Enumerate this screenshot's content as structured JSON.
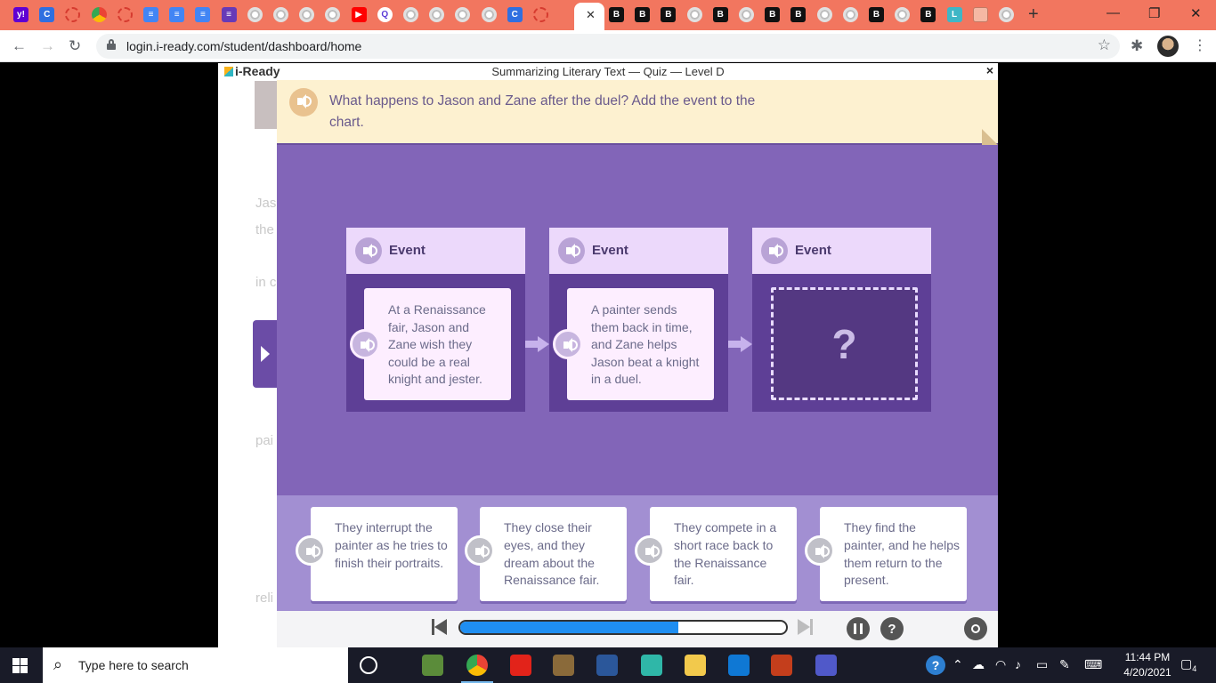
{
  "browser": {
    "tabs": [
      {
        "icon": "yahoo-icon",
        "glyph": "y!",
        "cls": "y"
      },
      {
        "icon": "c-app-icon",
        "glyph": "C",
        "cls": "c"
      },
      {
        "icon": "loading-icon",
        "glyph": "",
        "cls": "dots"
      },
      {
        "icon": "chrome-icon",
        "glyph": "",
        "cls": "ch"
      },
      {
        "icon": "loading-icon",
        "glyph": "",
        "cls": "dots"
      },
      {
        "icon": "google-docs-icon",
        "glyph": "≡",
        "cls": "docs"
      },
      {
        "icon": "google-docs-icon",
        "glyph": "≡",
        "cls": "docs"
      },
      {
        "icon": "google-docs-icon",
        "glyph": "≡",
        "cls": "docs"
      },
      {
        "icon": "google-forms-icon",
        "glyph": "≡",
        "cls": "form"
      },
      {
        "icon": "google-icon",
        "glyph": "",
        "cls": "g"
      },
      {
        "icon": "google-icon",
        "glyph": "",
        "cls": "g"
      },
      {
        "icon": "google-icon",
        "glyph": "",
        "cls": "g"
      },
      {
        "icon": "google-icon",
        "glyph": "",
        "cls": "g"
      },
      {
        "icon": "youtube-icon",
        "glyph": "▶",
        "cls": "yt"
      },
      {
        "icon": "quizlet-icon",
        "glyph": "Q",
        "cls": "q"
      },
      {
        "icon": "google-icon",
        "glyph": "",
        "cls": "g"
      },
      {
        "icon": "google-icon",
        "glyph": "",
        "cls": "g"
      },
      {
        "icon": "google-icon",
        "glyph": "",
        "cls": "g"
      },
      {
        "icon": "google-icon",
        "glyph": "",
        "cls": "g"
      },
      {
        "icon": "c-app-icon",
        "glyph": "C",
        "cls": "c"
      },
      {
        "icon": "loading-icon",
        "glyph": "",
        "cls": "dots"
      }
    ],
    "tabs_right": [
      {
        "icon": "b-app-icon",
        "glyph": "B",
        "cls": "b"
      },
      {
        "icon": "b-app-icon",
        "glyph": "B",
        "cls": "b"
      },
      {
        "icon": "b-app-icon",
        "glyph": "B",
        "cls": "b"
      },
      {
        "icon": "google-icon",
        "glyph": "",
        "cls": "g"
      },
      {
        "icon": "b-app-icon",
        "glyph": "B",
        "cls": "b"
      },
      {
        "icon": "google-icon",
        "glyph": "",
        "cls": "g"
      },
      {
        "icon": "b-app-icon",
        "glyph": "B",
        "cls": "b"
      },
      {
        "icon": "b-app-icon",
        "glyph": "B",
        "cls": "b"
      },
      {
        "icon": "google-icon",
        "glyph": "",
        "cls": "g"
      },
      {
        "icon": "google-icon",
        "glyph": "",
        "cls": "g"
      },
      {
        "icon": "b-app-icon",
        "glyph": "B",
        "cls": "b"
      },
      {
        "icon": "google-icon",
        "glyph": "",
        "cls": "g"
      },
      {
        "icon": "b-app-icon",
        "glyph": "B",
        "cls": "b"
      },
      {
        "icon": "l-app-icon",
        "glyph": "L",
        "cls": "lt"
      },
      {
        "icon": "calendar-icon",
        "glyph": "",
        "cls": "cal"
      },
      {
        "icon": "google-icon",
        "glyph": "",
        "cls": "g"
      }
    ],
    "url": "login.i-ready.com/student/dashboard/home"
  },
  "app": {
    "brand": "i-Ready",
    "title": "Summarizing Literary Text — Quiz — Level D",
    "close": "×"
  },
  "background_doc": {
    "fragments": [
      "Jas",
      "the",
      "in c",
      "pai",
      "reli"
    ]
  },
  "prompt": {
    "text": "What happens to Jason and Zane after the duel? Add the event to the chart."
  },
  "events": [
    {
      "label": "Event",
      "text": "At a Renaissance fair, Jason and Zane wish they could be a real knight and jester."
    },
    {
      "label": "Event",
      "text": "A painter sends them back in time, and Zane helps Jason beat a knight in a duel."
    },
    {
      "label": "Event",
      "text": "",
      "placeholder": "?"
    }
  ],
  "answers": [
    {
      "text": "They interrupt the painter as he tries to finish their portraits."
    },
    {
      "text": "They close their eyes, and they dream about the Renaissance fair."
    },
    {
      "text": "They compete in a short race back to the Renaissance fair."
    },
    {
      "text": "They find the painter, and he helps them return to the present."
    }
  ],
  "controls": {
    "progress_fraction": 0.67,
    "help": "?"
  },
  "taskbar": {
    "search_placeholder": "Type here to search",
    "time": "11:44 PM",
    "date": "4/20/2021",
    "notifications": "4",
    "apps": [
      {
        "name": "cortana-icon",
        "color": "transparent"
      },
      {
        "name": "minecraft-icon",
        "color": "#5b8c3a"
      },
      {
        "name": "chrome-icon",
        "color": "conic"
      },
      {
        "name": "roblox-icon",
        "color": "#e2231a"
      },
      {
        "name": "minecraft-dungeons-icon",
        "color": "#8a6a3a"
      },
      {
        "name": "word-icon",
        "color": "#2b579a"
      },
      {
        "name": "edge-icon",
        "color": "#2fb7a8"
      },
      {
        "name": "file-explorer-icon",
        "color": "#f2c94c"
      },
      {
        "name": "edge-browser-icon",
        "color": "#0f78d4"
      },
      {
        "name": "powerpoint-icon",
        "color": "#c43e1c"
      },
      {
        "name": "teams-icon",
        "color": "#5059c9"
      }
    ]
  }
}
